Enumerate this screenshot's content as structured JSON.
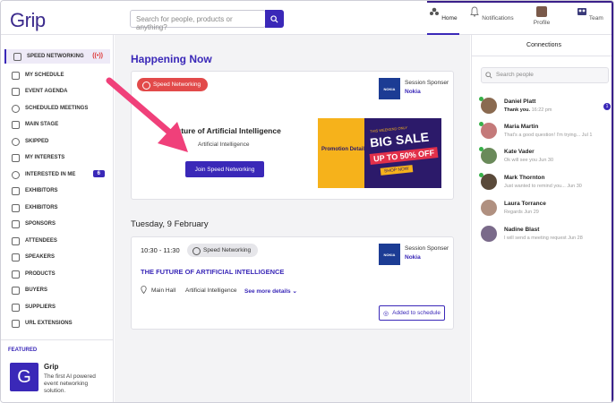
{
  "app": {
    "logo": "Grip"
  },
  "header": {
    "search_placeholder": "Search for people, products or anything?",
    "nav": [
      {
        "label": "Home"
      },
      {
        "label": "Notifications"
      },
      {
        "label": "Profile"
      },
      {
        "label": "Team"
      }
    ]
  },
  "sidebar": {
    "items": [
      {
        "label": "SPEED NETWORKING"
      },
      {
        "label": "MY SCHEDULE"
      },
      {
        "label": "EVENT AGENDA"
      },
      {
        "label": "SCHEDULED MEETINGS"
      },
      {
        "label": "MAIN STAGE"
      },
      {
        "label": "SKIPPED"
      },
      {
        "label": "MY INTERESTS"
      },
      {
        "label": "INTERESTED IN ME",
        "badge": "6"
      },
      {
        "label": "EXHIBITORS"
      },
      {
        "label": "EXHIBITORS"
      },
      {
        "label": "SPONSORS"
      },
      {
        "label": "ATTENDEES"
      },
      {
        "label": "SPEAKERS"
      },
      {
        "label": "PRODUCTS"
      },
      {
        "label": "BUYERS"
      },
      {
        "label": "SUPPLIERS"
      },
      {
        "label": "URL EXTENSIONS"
      }
    ],
    "featured": {
      "label": "FEATURED",
      "logo_letter": "G",
      "name": "Grip",
      "description": "The first AI powered event networking solution."
    }
  },
  "main": {
    "happening_now": "Happening Now",
    "card1": {
      "pill": "Speed Networking",
      "sponsor_label": "Session Sponser",
      "sponsor_name": "Nokia",
      "sponsor_logo": "NOKIA",
      "title": "uture of Artificial Intelligence",
      "subtitle": "Artificial Intelligence",
      "join_button": "Join Speed Networking",
      "banner": {
        "promo": "Promotion Detail",
        "small": "THIS WEEKEND ONLY",
        "big": "BIG SALE",
        "off": "UP TO 50% OFF",
        "shop": "SHOP NOW"
      }
    },
    "date_heading": "Tuesday, 9 February",
    "card2": {
      "time": "10:30 - 11:30",
      "pill": "Speed Networking",
      "sponsor_label": "Session Sponser",
      "sponsor_name": "Nokia",
      "sponsor_logo": "NOKIA",
      "title": "THE FUTURE OF ARTIFICIAL INTELLIGENCE",
      "location": "Main Hall",
      "topic": "Artificial Intelligence",
      "see_more": "See more details",
      "added_button": "Added to schedule"
    }
  },
  "connections": {
    "title": "Connections",
    "search_placeholder": "Search people",
    "people": [
      {
        "name": "Daniel Platt",
        "message": "Thank you.",
        "time": "16:22 pm",
        "unread": "1",
        "online": true,
        "color": "#8a6a50"
      },
      {
        "name": "Maria Martin",
        "message": "That's a good question! I'm trying...",
        "time": "Jul 1",
        "online": true,
        "color": "#c47a7a"
      },
      {
        "name": "Kate Vader",
        "message": "Ok will see you",
        "time": "Jun 30",
        "online": true,
        "color": "#6a8a5a"
      },
      {
        "name": "Mark Thornton",
        "message": "Just wanted to remind you...",
        "time": "Jun 30",
        "online": true,
        "color": "#5a4a3a"
      },
      {
        "name": "Laura Torrance",
        "message": "Regards",
        "time": "Jun 29",
        "online": false,
        "color": "#b09080"
      },
      {
        "name": "Nadine Blast",
        "message": "I will send a meeting request",
        "time": "Jun 28",
        "online": false,
        "color": "#7a6a8a"
      }
    ]
  }
}
